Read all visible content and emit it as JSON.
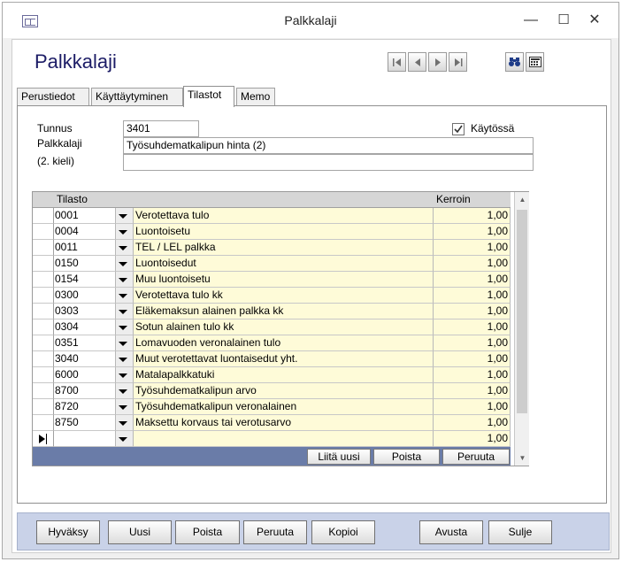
{
  "window": {
    "title": "Palkkalaji",
    "minimize_glyph": "—",
    "maximize_glyph": "☐",
    "close_glyph": "✕"
  },
  "form": {
    "title": "Palkkalaji"
  },
  "tabs": [
    {
      "label": "Perustiedot",
      "active": false
    },
    {
      "label": "Käyttäytyminen",
      "active": false
    },
    {
      "label": "Tilastot",
      "active": true
    },
    {
      "label": "Memo",
      "active": false
    }
  ],
  "fields": {
    "tunnus_label": "Tunnus",
    "tunnus_value": "3401",
    "palkkalaji_label": "Palkkalaji",
    "palkkalaji_value": "Työsuhdematkalipun hinta (2)",
    "kieli_label": "(2. kieli)",
    "kieli_value": "",
    "kaytossa_label": "Käytössä",
    "kaytossa_checked": true
  },
  "grid": {
    "col_tilasto": "Tilasto",
    "col_kerroin": "Kerroin",
    "rows": [
      {
        "code": "0001",
        "name": "Verotettava tulo",
        "kerroin": "1,00"
      },
      {
        "code": "0004",
        "name": "Luontoisetu",
        "kerroin": "1,00"
      },
      {
        "code": "0011",
        "name": "TEL / LEL palkka",
        "kerroin": "1,00"
      },
      {
        "code": "0150",
        "name": "Luontoisedut",
        "kerroin": "1,00"
      },
      {
        "code": "0154",
        "name": "Muu luontoisetu",
        "kerroin": "1,00"
      },
      {
        "code": "0300",
        "name": "Verotettava tulo kk",
        "kerroin": "1,00"
      },
      {
        "code": "0303",
        "name": "Eläkemaksun alainen palkka kk",
        "kerroin": "1,00"
      },
      {
        "code": "0304",
        "name": "Sotun alainen tulo kk",
        "kerroin": "1,00"
      },
      {
        "code": "0351",
        "name": "Lomavuoden veronalainen tulo",
        "kerroin": "1,00"
      },
      {
        "code": "3040",
        "name": "Muut verotettavat luontaisedut yht.",
        "kerroin": "1,00"
      },
      {
        "code": "6000",
        "name": "Matalapalkkatuki",
        "kerroin": "1,00"
      },
      {
        "code": "8700",
        "name": "Työsuhdematkalipun arvo",
        "kerroin": "1,00"
      },
      {
        "code": "8720",
        "name": "Työsuhdematkalipun veronalainen",
        "kerroin": "1,00"
      },
      {
        "code": "8750",
        "name": "Maksettu korvaus tai verotusarvo",
        "kerroin": "1,00"
      }
    ],
    "new_row": {
      "code": "",
      "name": "",
      "kerroin": "1,00"
    },
    "buttons": {
      "add": "Liitä uusi",
      "delete": "Poista",
      "cancel": "Peruuta"
    }
  },
  "bottom_buttons": {
    "accept": "Hyväksy",
    "new": "Uusi",
    "delete": "Poista",
    "cancel": "Peruuta",
    "copy": "Kopioi",
    "help": "Avusta",
    "close": "Sulje"
  },
  "icons": {
    "first": "first-record-icon",
    "prev": "previous-record-icon",
    "next": "next-record-icon",
    "last": "last-record-icon",
    "find": "binoculars-icon",
    "calc": "calculator-icon"
  }
}
